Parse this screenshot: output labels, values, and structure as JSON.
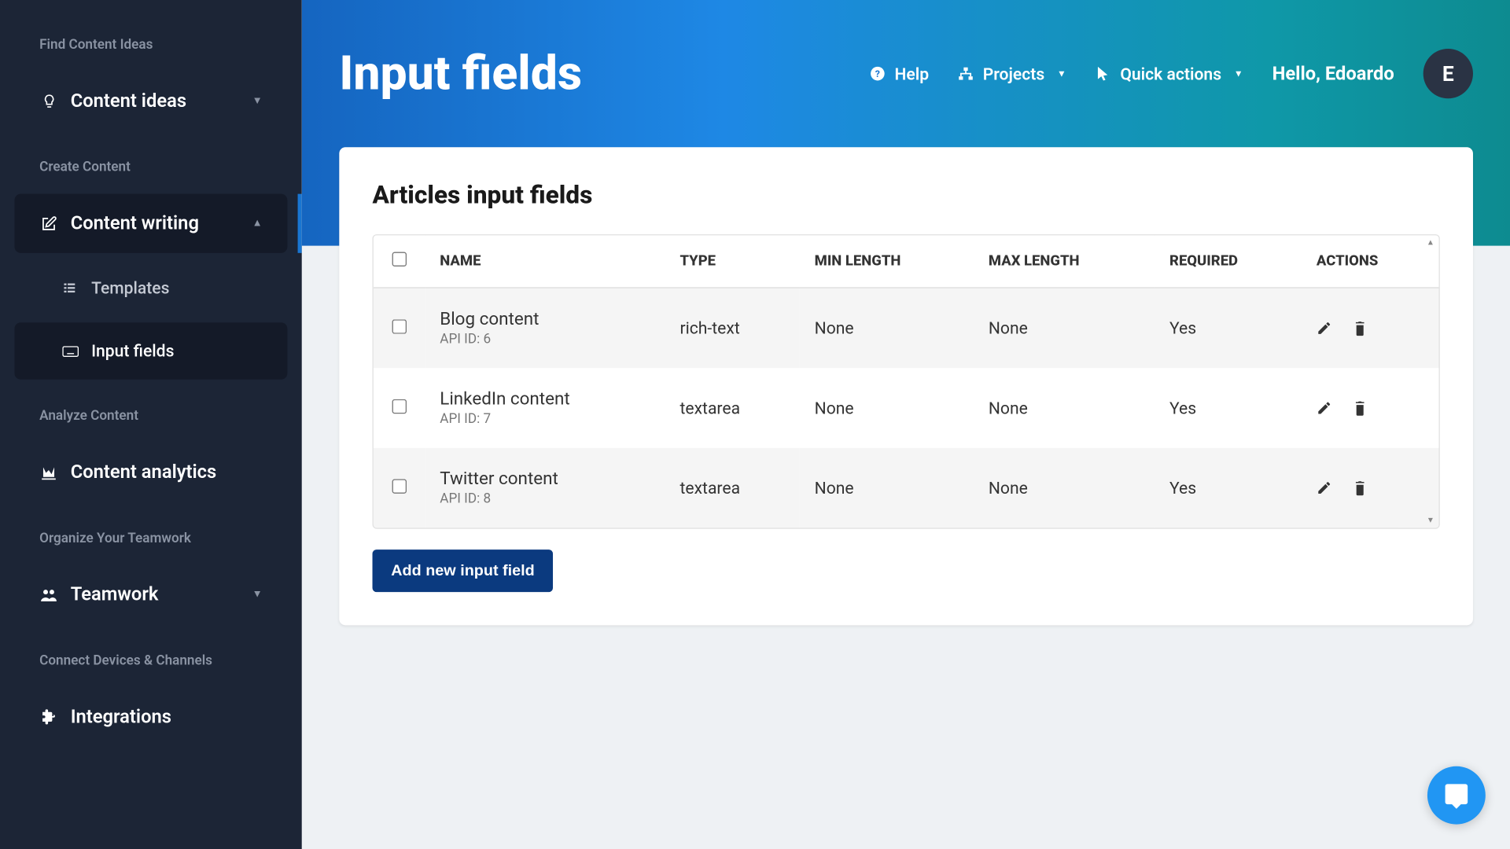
{
  "sidebar": {
    "sections": [
      {
        "label": "Find Content Ideas",
        "items": [
          {
            "label": "Content ideas",
            "icon": "lightbulb",
            "dropdown": true
          }
        ]
      },
      {
        "label": "Create Content",
        "items": [
          {
            "label": "Content writing",
            "icon": "edit",
            "dropdown": true,
            "open": true,
            "active": true,
            "children": [
              {
                "label": "Templates",
                "icon": "list"
              },
              {
                "label": "Input fields",
                "icon": "keyboard",
                "active": true
              }
            ]
          }
        ]
      },
      {
        "label": "Analyze Content",
        "items": [
          {
            "label": "Content analytics",
            "icon": "chart"
          }
        ]
      },
      {
        "label": "Organize Your Teamwork",
        "items": [
          {
            "label": "Teamwork",
            "icon": "users",
            "dropdown": true
          }
        ]
      },
      {
        "label": "Connect Devices & Channels",
        "items": [
          {
            "label": "Integrations",
            "icon": "puzzle"
          }
        ]
      }
    ]
  },
  "header": {
    "title": "Input fields",
    "help": "Help",
    "projects": "Projects",
    "quick_actions": "Quick actions",
    "greeting": "Hello, Edoardo",
    "avatar_initial": "E"
  },
  "card": {
    "title": "Articles input fields",
    "columns": [
      "NAME",
      "TYPE",
      "MIN LENGTH",
      "MAX LENGTH",
      "REQUIRED",
      "ACTIONS"
    ],
    "rows": [
      {
        "name": "Blog content",
        "api_id": "API ID: 6",
        "type": "rich-text",
        "min_length": "None",
        "max_length": "None",
        "required": "Yes"
      },
      {
        "name": "LinkedIn content",
        "api_id": "API ID: 7",
        "type": "textarea",
        "min_length": "None",
        "max_length": "None",
        "required": "Yes"
      },
      {
        "name": "Twitter content",
        "api_id": "API ID: 8",
        "type": "textarea",
        "min_length": "None",
        "max_length": "None",
        "required": "Yes"
      }
    ],
    "add_button": "Add new input field"
  }
}
